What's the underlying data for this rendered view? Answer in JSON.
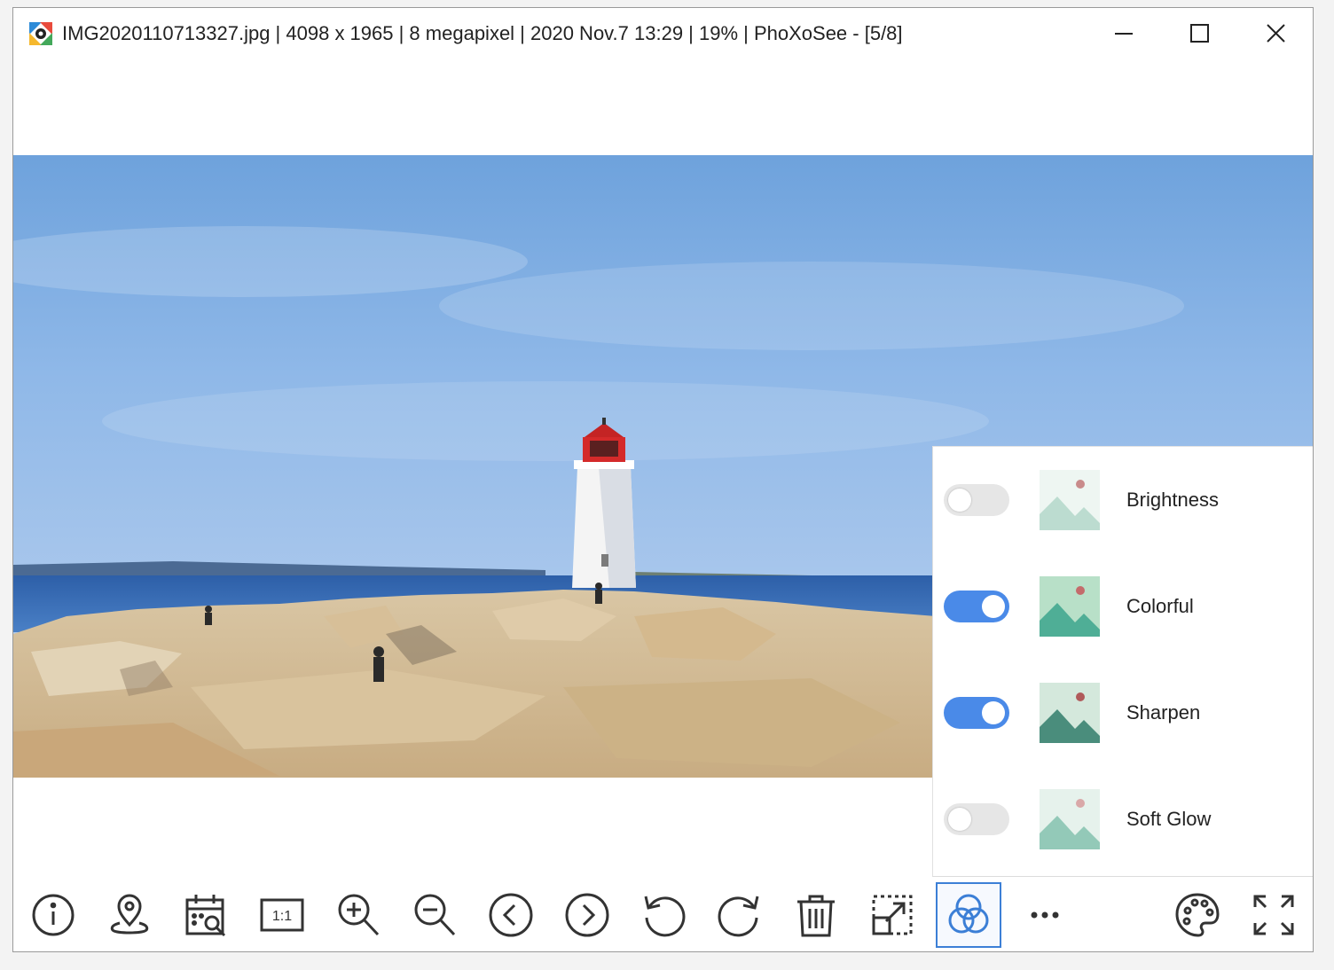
{
  "window": {
    "title": "IMG2020110713327.jpg  |  4098 x 1965  |  8 megapixel  |  2020 Nov.7 13:29  |  19%  |  PhoXoSee  -  [5/8]",
    "controls": [
      "minimize-icon",
      "maximize-icon",
      "close-icon"
    ]
  },
  "filters": [
    {
      "label": "Brightness",
      "enabled": false
    },
    {
      "label": "Colorful",
      "enabled": true
    },
    {
      "label": "Sharpen",
      "enabled": true
    },
    {
      "label": "Soft Glow",
      "enabled": false
    }
  ],
  "toolbar": {
    "buttons": [
      {
        "name": "info-icon"
      },
      {
        "name": "location-pin-icon"
      },
      {
        "name": "calendar-search-icon"
      },
      {
        "name": "actual-size-icon",
        "text": "1:1"
      },
      {
        "name": "zoom-in-icon"
      },
      {
        "name": "zoom-out-icon"
      },
      {
        "name": "previous-icon"
      },
      {
        "name": "next-icon"
      },
      {
        "name": "rotate-left-icon"
      },
      {
        "name": "rotate-right-icon"
      },
      {
        "name": "delete-icon"
      },
      {
        "name": "resize-icon"
      },
      {
        "name": "filter-effects-icon",
        "active": true
      },
      {
        "name": "more-icon"
      },
      {
        "name": "palette-icon"
      },
      {
        "name": "fullscreen-icon"
      }
    ]
  },
  "colors": {
    "accent": "#4a8ae8",
    "active_border": "#3c7fd6",
    "toggle_off": "#e6e6e6",
    "lighthouse_red": "#d42a2a"
  }
}
